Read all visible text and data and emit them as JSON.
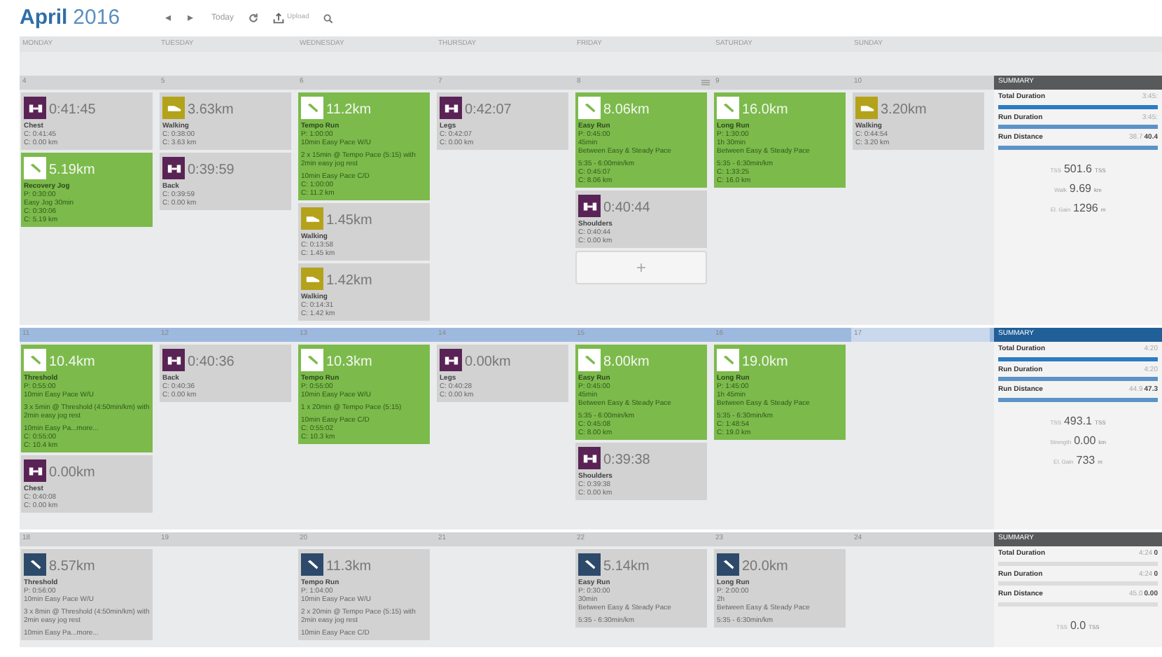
{
  "header": {
    "month": "April",
    "year": "2016",
    "prev": "◂",
    "next": "▸",
    "today": "Today",
    "upload": "Upload"
  },
  "day_names": [
    "MONDAY",
    "TUESDAY",
    "WEDNESDAY",
    "THURSDAY",
    "FRIDAY",
    "SATURDAY",
    "SUNDAY"
  ],
  "weeks": [
    {
      "selected": false,
      "days": [
        {
          "date": "4",
          "today": false,
          "note": false,
          "cards": [
            {
              "kind": "strength",
              "completed": true,
              "headline": "0:41:45",
              "title": "Chest",
              "blocks": [
                [
                  "C: 0:41:45",
                  "C: 0.00 km"
                ]
              ]
            },
            {
              "kind": "run",
              "completed": true,
              "headline": "5.19km",
              "title": "Recovery Jog",
              "blocks": [
                [
                  "P: 0:30:00",
                  "Easy Jog 30min",
                  "C: 0:30:06",
                  "C: 5.19 km"
                ]
              ]
            }
          ]
        },
        {
          "date": "5",
          "today": false,
          "note": false,
          "cards": [
            {
              "kind": "walk",
              "completed": true,
              "headline": "3.63km",
              "title": "Walking",
              "blocks": [
                [
                  "C: 0:38:00",
                  "C: 3.63 km"
                ]
              ]
            },
            {
              "kind": "strength",
              "completed": true,
              "headline": "0:39:59",
              "title": "Back",
              "blocks": [
                [
                  "C: 0:39:59",
                  "C: 0.00 km"
                ]
              ]
            }
          ]
        },
        {
          "date": "6",
          "today": false,
          "note": false,
          "cards": [
            {
              "kind": "run",
              "completed": true,
              "headline": "11.2km",
              "title": "Tempo Run",
              "blocks": [
                [
                  "P: 1:00:00",
                  "10min Easy Pace W/U"
                ],
                [
                  "2 x 15min @ Tempo Pace (5:15) with 2min easy jog rest"
                ],
                [
                  "10min Easy Pace C/D",
                  "C: 1:00:00",
                  "C: 11.2 km"
                ]
              ]
            },
            {
              "kind": "walk",
              "completed": true,
              "headline": "1.45km",
              "title": "Walking",
              "blocks": [
                [
                  "C: 0:13:58",
                  "C: 1.45 km"
                ]
              ]
            },
            {
              "kind": "walk",
              "completed": true,
              "headline": "1.42km",
              "title": "Walking",
              "blocks": [
                [
                  "C: 0:14:31",
                  "C: 1.42 km"
                ]
              ]
            }
          ]
        },
        {
          "date": "7",
          "today": false,
          "note": false,
          "cards": [
            {
              "kind": "strength",
              "completed": true,
              "headline": "0:42:07",
              "title": "Legs",
              "blocks": [
                [
                  "C: 0:42:07",
                  "C: 0.00 km"
                ]
              ]
            }
          ]
        },
        {
          "date": "8",
          "today": false,
          "note": true,
          "cards": [
            {
              "kind": "run",
              "completed": true,
              "headline": "8.06km",
              "title": "Easy Run",
              "blocks": [
                [
                  "P: 0:45:00",
                  "45min",
                  "Between Easy & Steady Pace"
                ],
                [
                  "5:35 - 6:00min/km",
                  "C: 0:45:07",
                  "C: 8.06 km"
                ]
              ]
            },
            {
              "kind": "strength",
              "completed": true,
              "headline": "0:40:44",
              "title": "Shoulders",
              "blocks": [
                [
                  "C: 0:40:44",
                  "C: 0.00 km"
                ]
              ]
            },
            {
              "kind": "add",
              "label": "+"
            }
          ]
        },
        {
          "date": "9",
          "today": false,
          "note": false,
          "cards": [
            {
              "kind": "run",
              "completed": true,
              "headline": "16.0km",
              "title": "Long Run",
              "blocks": [
                [
                  "P: 1:30:00",
                  "1h 30min",
                  "Between Easy & Steady Pace"
                ],
                [
                  "5:35 - 6:30min/km",
                  "C: 1:33:25",
                  "C: 16.0 km"
                ]
              ]
            }
          ]
        },
        {
          "date": "10",
          "today": false,
          "note": false,
          "cards": [
            {
              "kind": "walk",
              "completed": true,
              "headline": "3.20km",
              "title": "Walking",
              "blocks": [
                [
                  "C: 0:44:54",
                  "C: 3.20 km"
                ]
              ]
            }
          ]
        }
      ],
      "summary": {
        "title": "SUMMARY",
        "rows": [
          {
            "label": "Total Duration",
            "values": [
              "3:45:"
            ],
            "level": 1
          },
          {
            "label": "Run Duration",
            "values": [
              "3:45:"
            ],
            "level": 1
          },
          {
            "label": "Run Distance",
            "values": [
              "38.7",
              "40.4"
            ],
            "level": 1
          }
        ],
        "stats": [
          {
            "label": "TSS",
            "value": "501.6",
            "unit": "TSS"
          },
          {
            "label": "Walk",
            "value": "9.69",
            "unit": "km"
          },
          {
            "label": "El. Gain",
            "value": "1296",
            "unit": "m"
          }
        ]
      }
    },
    {
      "selected": true,
      "days": [
        {
          "date": "11",
          "today": false,
          "note": false,
          "cards": [
            {
              "kind": "run",
              "completed": true,
              "headline": "10.4km",
              "title": "Threshold",
              "blocks": [
                [
                  "P: 0:55:00",
                  "10min Easy Pace W/U"
                ],
                [
                  "3 x 5min @ Threshold (4:50min/km) with 2min easy jog rest"
                ],
                [
                  "10min Easy Pa...more...",
                  "C: 0:55:00",
                  "C: 10.4 km"
                ]
              ]
            },
            {
              "kind": "strength",
              "completed": true,
              "headline": "0.00km",
              "title": "Chest",
              "blocks": [
                [
                  "C: 0:40:08",
                  "C: 0.00 km"
                ]
              ]
            }
          ]
        },
        {
          "date": "12",
          "today": false,
          "note": false,
          "cards": [
            {
              "kind": "strength",
              "completed": true,
              "headline": "0:40:36",
              "title": "Back",
              "blocks": [
                [
                  "C: 0:40:36",
                  "C: 0.00 km"
                ]
              ]
            }
          ]
        },
        {
          "date": "13",
          "today": false,
          "note": false,
          "cards": [
            {
              "kind": "run",
              "completed": true,
              "headline": "10.3km",
              "title": "Tempo Run",
              "blocks": [
                [
                  "P: 0:55:00",
                  "10min Easy Pace W/U"
                ],
                [
                  "1 x 20min @ Tempo Pace (5:15)"
                ],
                [
                  "10min Easy Pace C/D",
                  "C: 0:55:02",
                  "C: 10.3 km"
                ]
              ]
            }
          ]
        },
        {
          "date": "14",
          "today": false,
          "note": false,
          "cards": [
            {
              "kind": "strength",
              "completed": true,
              "headline": "0.00km",
              "title": "Legs",
              "blocks": [
                [
                  "C: 0:40:28",
                  "C: 0.00 km"
                ]
              ]
            }
          ]
        },
        {
          "date": "15",
          "today": false,
          "note": false,
          "cards": [
            {
              "kind": "run",
              "completed": true,
              "headline": "8.00km",
              "title": "Easy Run",
              "blocks": [
                [
                  "P: 0:45:00",
                  "45min",
                  "Between Easy & Steady Pace"
                ],
                [
                  "5:35 - 6:00min/km",
                  "C: 0:45:08",
                  "C: 8.00 km"
                ]
              ]
            },
            {
              "kind": "strength",
              "completed": true,
              "headline": "0:39:38",
              "title": "Shoulders",
              "blocks": [
                [
                  "C: 0:39:38",
                  "C: 0.00 km"
                ]
              ]
            }
          ]
        },
        {
          "date": "16",
          "today": false,
          "note": false,
          "cards": [
            {
              "kind": "run",
              "completed": true,
              "headline": "19.0km",
              "title": "Long Run",
              "blocks": [
                [
                  "P: 1:45:00",
                  "1h 45min",
                  "Between Easy & Steady Pace"
                ],
                [
                  "5:35 - 6:30min/km",
                  "C: 1:48:54",
                  "C: 19.0 km"
                ]
              ]
            }
          ]
        },
        {
          "date": "17",
          "today": true,
          "note": false
        }
      ],
      "summary": {
        "title": "SUMMARY",
        "rows": [
          {
            "label": "Total Duration",
            "values": [
              "4:20"
            ],
            "level": 1
          },
          {
            "label": "Run Duration",
            "values": [
              "4:20"
            ],
            "level": 1
          },
          {
            "label": "Run Distance",
            "values": [
              "44.9",
              "47.3"
            ],
            "level": 1
          }
        ],
        "stats": [
          {
            "label": "TSS",
            "value": "493.1",
            "unit": "TSS"
          },
          {
            "label": "Strength",
            "value": "0.00",
            "unit": "km"
          },
          {
            "label": "El. Gain",
            "value": "733",
            "unit": "m"
          }
        ]
      }
    },
    {
      "selected": false,
      "days": [
        {
          "date": "18",
          "today": false,
          "note": false,
          "cards": [
            {
              "kind": "run",
              "completed": false,
              "headline": "8.57km",
              "title": "Threshold",
              "blocks": [
                [
                  "P: 0:56:00",
                  "10min Easy Pace W/U"
                ],
                [
                  "3 x 8min @ Threshold (4:50min/km) with 2min easy jog rest"
                ],
                [
                  "10min Easy Pa...more..."
                ]
              ]
            }
          ]
        },
        {
          "date": "19",
          "today": false,
          "note": false
        },
        {
          "date": "20",
          "today": false,
          "note": false,
          "cards": [
            {
              "kind": "run",
              "completed": false,
              "headline": "11.3km",
              "title": "Tempo Run",
              "blocks": [
                [
                  "P: 1:04:00",
                  "10min Easy Pace W/U"
                ],
                [
                  "2 x 20min @ Tempo Pace (5:15) with 2min easy jog rest"
                ],
                [
                  "10min Easy Pace C/D"
                ]
              ]
            }
          ]
        },
        {
          "date": "21",
          "today": false,
          "note": false
        },
        {
          "date": "22",
          "today": false,
          "note": false,
          "cards": [
            {
              "kind": "run",
              "completed": false,
              "headline": "5.14km",
              "title": "Easy Run",
              "blocks": [
                [
                  "P: 0:30:00",
                  "30min",
                  "Between Easy & Steady Pace"
                ],
                [
                  "5:35 - 6:30min/km"
                ]
              ]
            }
          ]
        },
        {
          "date": "23",
          "today": false,
          "note": false,
          "cards": [
            {
              "kind": "run",
              "completed": false,
              "headline": "20.0km",
              "title": "Long Run",
              "blocks": [
                [
                  "P: 2:00:00",
                  "2h",
                  "Between Easy & Steady Pace"
                ],
                [
                  "5:35 - 6:30min/km"
                ]
              ]
            }
          ]
        },
        {
          "date": "24",
          "today": false,
          "note": false
        }
      ],
      "summary": {
        "title": "SUMMARY",
        "rows": [
          {
            "label": "Total Duration",
            "values": [
              "4:24",
              "0"
            ],
            "level": 0
          },
          {
            "label": "Run Duration",
            "values": [
              "4:24",
              "0"
            ],
            "level": 0
          },
          {
            "label": "Run Distance",
            "values": [
              "45.0",
              "0.00"
            ],
            "level": 0
          }
        ],
        "stats": [
          {
            "label": "TSS",
            "value": "0.0",
            "unit": "TSS"
          }
        ]
      }
    }
  ]
}
